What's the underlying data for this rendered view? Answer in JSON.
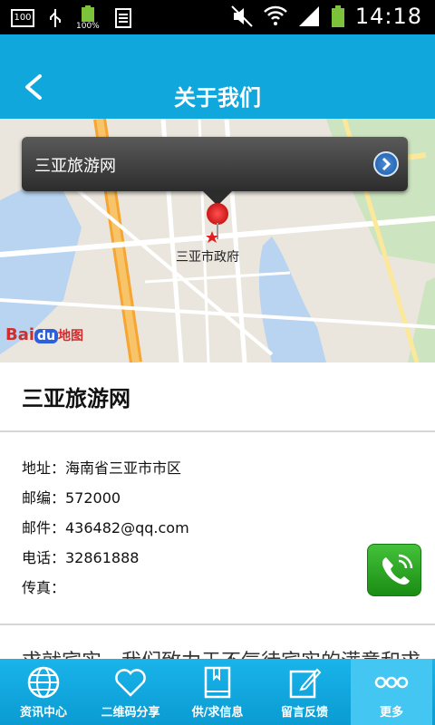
{
  "status_bar": {
    "time": "14:18",
    "battery_percent": "100%",
    "storage": "100"
  },
  "header": {
    "title": "关于我们",
    "back_icon": "chevron-left-icon"
  },
  "map": {
    "callout_title": "三亚旅游网",
    "poi_label": "三亚市政府",
    "logo": "Baidu地图"
  },
  "company": {
    "name": "三亚旅游网",
    "address": "地址：海南省三亚市市区",
    "postcode": "邮编：572000",
    "email": "邮件：436482@qq.com",
    "phone": "电话：32861888",
    "fax": "传真："
  },
  "description_preview": "求就宾实，我们致力于不气待宾实的满意和求",
  "tabs": [
    {
      "label": "资讯中心",
      "icon": "globe-icon"
    },
    {
      "label": "二维码分享",
      "icon": "heart-icon"
    },
    {
      "label": "供/求信息",
      "icon": "book-icon"
    },
    {
      "label": "留言反馈",
      "icon": "edit-icon"
    },
    {
      "label": "更多",
      "icon": "more-icon"
    }
  ]
}
